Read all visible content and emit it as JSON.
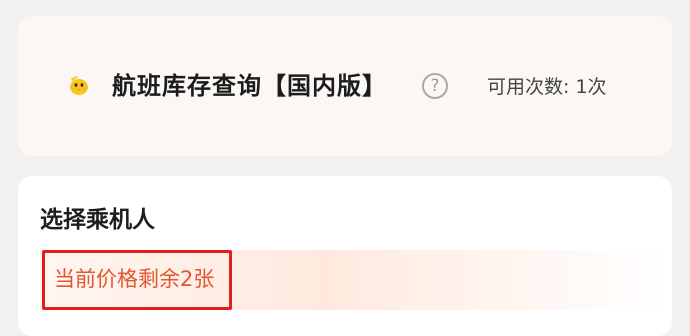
{
  "header": {
    "title": "航班库存查询【国内版】",
    "help": "?",
    "usage": "可用次数: 1次",
    "mascot_icon": "chick-mascot-icon"
  },
  "passenger": {
    "section_title": "选择乘机人",
    "price_notice": "当前价格剩余2张"
  },
  "colors": {
    "notice_text": "#e2572f",
    "highlight_border": "#e01e1e",
    "mascot": "#f6c619"
  }
}
